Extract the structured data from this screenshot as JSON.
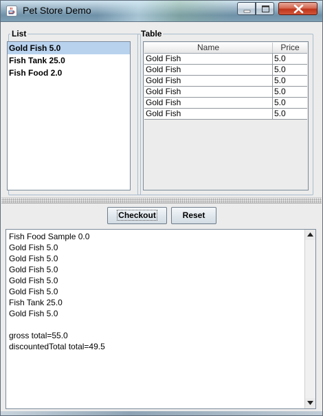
{
  "window": {
    "title": "Pet Store Demo"
  },
  "list_panel": {
    "legend": "List",
    "items": [
      "Gold Fish 5.0",
      "Fish Tank 25.0",
      "Fish Food 2.0"
    ],
    "selected_index": 0
  },
  "table_panel": {
    "legend": "Table",
    "columns": [
      "Name",
      "Price"
    ],
    "rows": [
      [
        "Gold Fish",
        "5.0"
      ],
      [
        "Gold Fish",
        "5.0"
      ],
      [
        "Gold Fish",
        "5.0"
      ],
      [
        "Gold Fish",
        "5.0"
      ],
      [
        "Gold Fish",
        "5.0"
      ],
      [
        "Gold Fish",
        "5.0"
      ]
    ]
  },
  "buttons": {
    "checkout": "Checkout",
    "reset": "Reset"
  },
  "output": {
    "lines": [
      "Fish Food Sample 0.0",
      "Gold Fish 5.0",
      "Gold Fish 5.0",
      "Gold Fish 5.0",
      "Gold Fish 5.0",
      "Gold Fish 5.0",
      "Fish Tank 25.0",
      "Gold Fish 5.0",
      "",
      "gross total=55.0",
      "discountedTotal total=49.5"
    ]
  },
  "colors": {
    "selection": "#b8d2ee",
    "close_button": "#c0361c",
    "group_border": "#a8bccd"
  }
}
